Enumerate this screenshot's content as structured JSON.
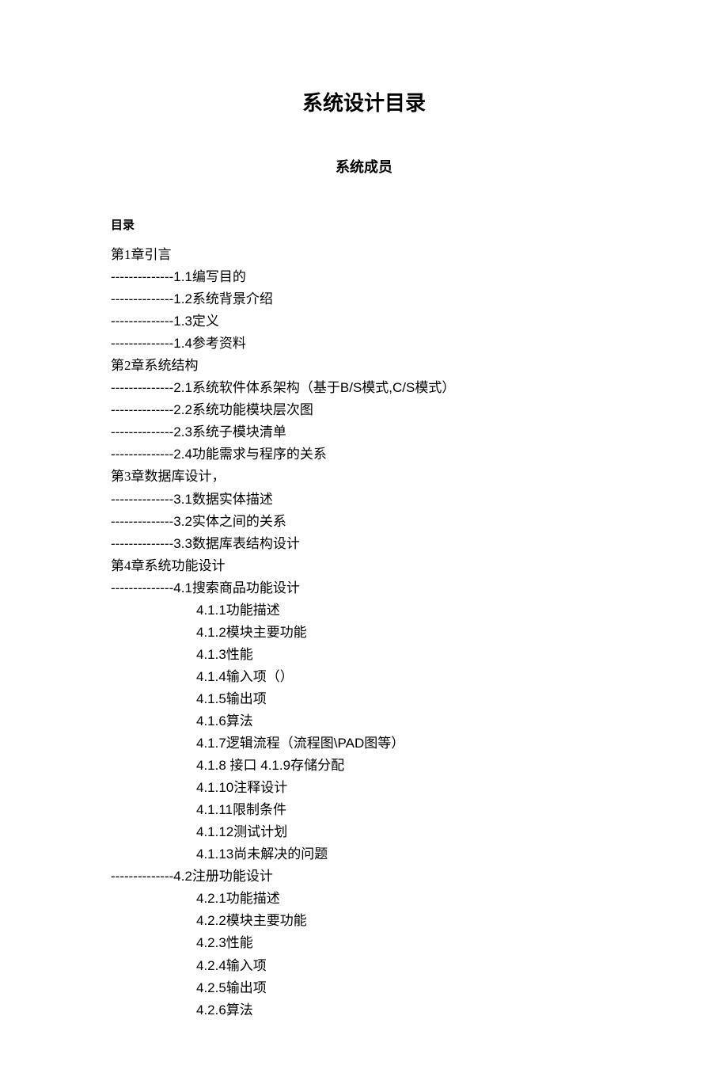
{
  "title": "系统设计目录",
  "subtitle": "系统成员",
  "toc_label": "目录",
  "dash_prefix": " --------------",
  "dash_prefix_nb": "--------------",
  "lines": {
    "ch1": "第1章引言",
    "l1_1": "1.1编写目的",
    "l1_2": "1.2系统背景介绍",
    "l1_3": "1.3定义",
    "l1_4": "1.4参考资料",
    "ch2": "第2章系统结构",
    "l2_1": "2.1系统软件体系架构（基于B/S模式,C/S模式）",
    "l2_2": "2.2系统功能模块层次图",
    "l2_3": "2.3系统子模块清单",
    "l2_4": "2.4功能需求与程序的关系",
    "ch3": "第3章数据库设计，",
    "l3_1": "3.1数据实体描述",
    "l3_2": "3.2实体之间的关系",
    "l3_3": "3.3数据库表结构设计",
    "ch4": "第4章系统功能设计",
    "l4_1": "4.1搜索商品功能设计",
    "l4_1_1": "4.1.1功能描述",
    "l4_1_2": "4.1.2模块主要功能",
    "l4_1_3": "4.1.3性能",
    "l4_1_4": "4.1.4输入项（）",
    "l4_1_5": "4.1.5输出项",
    "l4_1_6": "4.1.6算法",
    "l4_1_7": "4.1.7逻辑流程（流程图\\PAD图等）",
    "l4_1_8_9": " 4.1.8 接口  4.1.9存储分配",
    "l4_1_10": "4.1.10注释设计",
    "l4_1_11": "4.1.11限制条件",
    "l4_1_12": "4.1.12测试计划",
    "l4_1_13": "4.1.13尚未解决的问题",
    "l4_2": "4.2注册功能设计",
    "l4_2_1": "4.2.1功能描述",
    "l4_2_2": "4.2.2模块主要功能",
    "l4_2_3": "4.2.3性能",
    "l4_2_4": "4.2.4输入项",
    "l4_2_5": "4.2.5输出项",
    "l4_2_6": "4.2.6算法"
  }
}
